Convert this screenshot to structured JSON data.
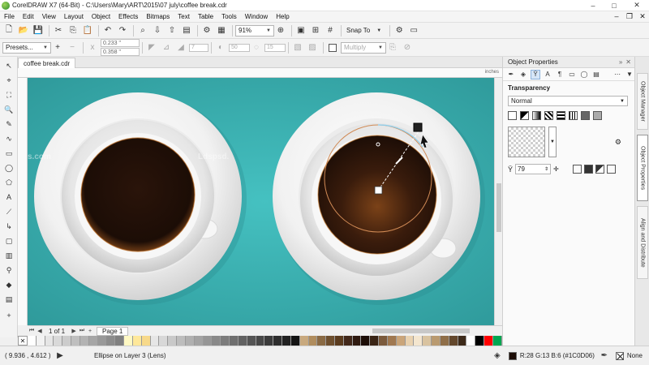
{
  "window": {
    "title": "CorelDRAW X7 (64-Bit) - C:\\Users\\Mary\\ART\\2015\\07 july\\coffee break.cdr",
    "controls": [
      "–",
      "□",
      "✕"
    ]
  },
  "menu": [
    "File",
    "Edit",
    "View",
    "Layout",
    "Object",
    "Effects",
    "Bitmaps",
    "Text",
    "Table",
    "Tools",
    "Window",
    "Help"
  ],
  "toolbar": {
    "zoom": "91%",
    "snap_to": "Snap To"
  },
  "property_bar": {
    "presets": "Presets...",
    "x": "0.233 \"",
    "y": "0.358 \"",
    "value1": "7",
    "value2": "50",
    "value3": "15",
    "merge_mode": "Multiply"
  },
  "document": {
    "tab": "coffee break.cdr",
    "ruler_unit": "inches",
    "page_counter": "1 of 1",
    "page_tab": "Page 1"
  },
  "docker": {
    "title": "Object Properties",
    "section": "Transparency",
    "blend_mode": "Normal",
    "transparency_value": "79"
  },
  "side_tabs": [
    "Object Manager",
    "Object Properties",
    "Align and Distribute"
  ],
  "status": {
    "coords": "( 9.936 , 4.612 )",
    "object_info": "Ellipse on Layer 3  (Lens)",
    "fill_info": "R:28 G:13 B:6 (#1C0D06)",
    "outline_info": "None"
  },
  "palette": [
    "#ffffff",
    "#f2f2f2",
    "#e5e5e5",
    "#d9d9d9",
    "#cccccc",
    "#bfbfbf",
    "#b3b3b3",
    "#a6a6a6",
    "#999999",
    "#8c8c8c",
    "#808080",
    "#fff9c4",
    "#ffe89a",
    "#f7d98a",
    "#e6e6e6",
    "#d8d8d8",
    "#c9c9c9",
    "#bdbdbd",
    "#b0b0b0",
    "#a3a3a3",
    "#969696",
    "#898989",
    "#7c7c7c",
    "#6f6f6f",
    "#626262",
    "#555555",
    "#484848",
    "#3b3b3b",
    "#2e2e2e",
    "#212121",
    "#141414",
    "#c8a97e",
    "#b08d5e",
    "#8a6a44",
    "#6e4f2e",
    "#5a3b1e",
    "#42281a",
    "#2f1a10",
    "#1c0d06",
    "#3a2415",
    "#7b5a3c",
    "#a07850",
    "#caa57a",
    "#e9d2b0",
    "#f4e6cf",
    "#d9c3a0",
    "#b99a70",
    "#8f6e48",
    "#63472c",
    "#3d2a1a",
    "#ffffff",
    "#000000",
    "#ff0000",
    "#00a651"
  ],
  "colors": {
    "canvas": "#39aeaf",
    "coffee": "#1c0d06"
  }
}
